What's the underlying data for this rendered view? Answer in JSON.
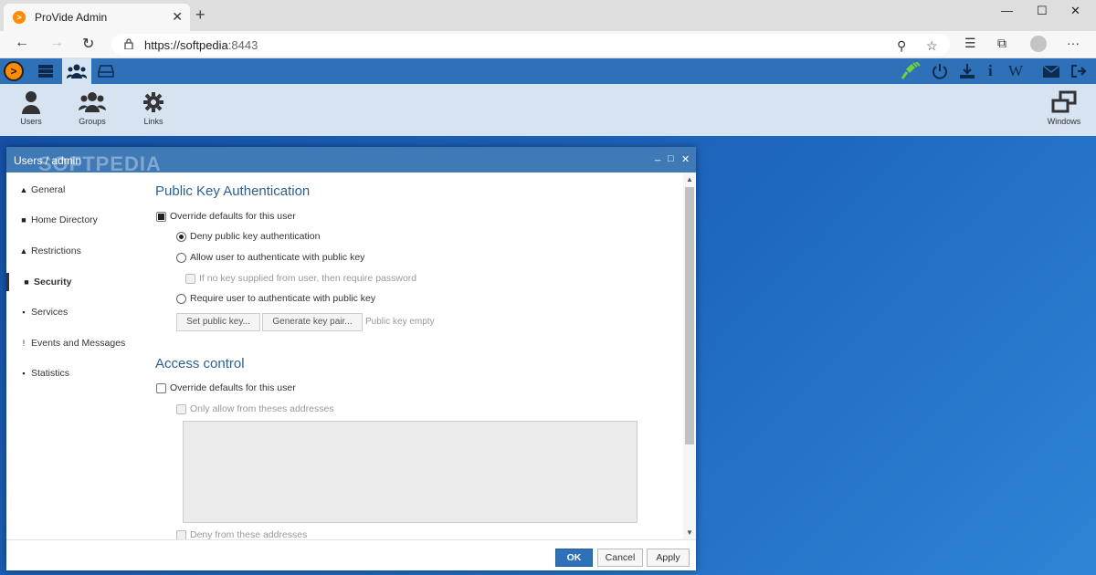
{
  "browser": {
    "tab_title": "ProVide Admin",
    "tab_favicon": ">",
    "new_tab": "+",
    "close_tab": "✕",
    "minimize": "—",
    "maximize": "☐",
    "close_window": "✕",
    "url_host": "https://softpedia",
    "url_port": ":8443",
    "back": "←",
    "forward": "→",
    "refresh": "↻",
    "key_icon": "⚲",
    "star_icon": "☆",
    "favorites_icon": "☰",
    "collections_icon": "⧉",
    "more_icon": "···"
  },
  "app": {
    "logo": ">",
    "ribbon": [
      {
        "label": "Users"
      },
      {
        "label": "Groups"
      },
      {
        "label": "Links"
      },
      {
        "label": "Windows"
      }
    ],
    "top_icons": {
      "info": "i",
      "wiki": "W"
    }
  },
  "dialog": {
    "title": "Users / admin",
    "watermark": "SOFTPEDIA",
    "minimize": "_",
    "maximize": "□",
    "close": "✕",
    "sidebar": [
      {
        "label": "General",
        "icon": "▲"
      },
      {
        "label": "Home Directory",
        "icon": "■"
      },
      {
        "label": "Restrictions",
        "icon": "▲"
      },
      {
        "label": "Security",
        "icon": "■"
      },
      {
        "label": "Services",
        "icon": "▪"
      },
      {
        "label": "Events and Messages",
        "icon": "!"
      },
      {
        "label": "Statistics",
        "icon": "▪"
      }
    ],
    "public_key": {
      "heading": "Public Key Authentication",
      "override": "Override defaults for this user",
      "deny": "Deny public key authentication",
      "allow": "Allow user to authenticate with public key",
      "require_password": "If no key supplied from user, then require password",
      "require": "Require user to authenticate with public key",
      "set_key_button": "Set public key...",
      "generate_button": "Generate key pair...",
      "status": "Public key empty"
    },
    "access_control": {
      "heading": "Access control",
      "override": "Override defaults for this user",
      "only_allow": "Only allow from theses addresses",
      "deny_from": "Deny from these addresses"
    },
    "footer": {
      "ok": "OK",
      "cancel": "Cancel",
      "apply": "Apply"
    }
  }
}
